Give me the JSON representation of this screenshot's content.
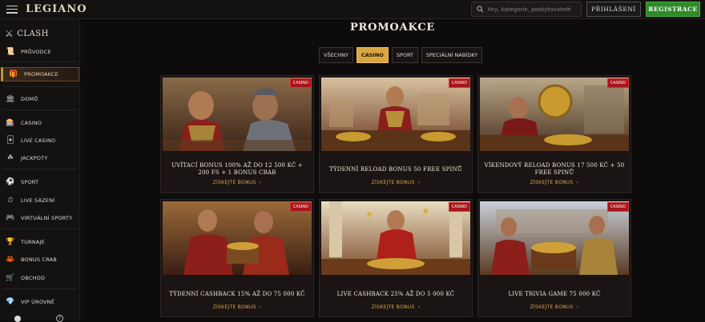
{
  "header": {
    "logo": "LEGIANO",
    "search_placeholder": "Hry, kategorie, poskytovatelé",
    "login_label": "PŘIHLÁŠENÍ",
    "register_label": "REGISTRACE"
  },
  "sidebar": {
    "clash": "CLASH",
    "items": [
      {
        "label": "PRŮVODCE",
        "icon": "scroll-icon"
      },
      {
        "label": "PROMOAKCE",
        "icon": "gift-icon"
      },
      {
        "label": "DOMŮ",
        "icon": "temple-icon"
      },
      {
        "label": "CASINO",
        "icon": "slot-machine-icon"
      },
      {
        "label": "LIVE CASINO",
        "icon": "live-dealer-icon"
      },
      {
        "label": "JACKPOTY",
        "icon": "clover-icon"
      },
      {
        "label": "SPORT",
        "icon": "soccer-ball-icon"
      },
      {
        "label": "LIVE SÁZENÍ",
        "icon": "live-betting-icon"
      },
      {
        "label": "VIRTUÁLNÍ SPORTY",
        "icon": "gamepad-icon"
      },
      {
        "label": "TURNAJE",
        "icon": "trophy-icon"
      },
      {
        "label": "BONUS CRAB",
        "icon": "crab-icon"
      },
      {
        "label": "OBCHOD",
        "icon": "shop-icon"
      },
      {
        "label": "VIP ÚROVNĚ",
        "icon": "diamond-icon"
      }
    ]
  },
  "main": {
    "title": "PROMOAKCE",
    "filters": [
      "VŠECHNY",
      "CASINO",
      "SPORT",
      "SPECIÁLNÍ NABÍDKY"
    ],
    "active_filter": "CASINO",
    "cta": "ZÍSKEJTE BONUS",
    "cards": [
      {
        "badge": "CASINO",
        "title": "UVÍTACÍ BONUS 100% AŽ DO 12 500 KČ + 200 FS + 1 BONUS CRAB"
      },
      {
        "badge": "CASINO",
        "title": "TÝDENNÍ RELOAD BONUS 50 FREE SPINŮ"
      },
      {
        "badge": "CASINO",
        "title": "VÍKENDOVÝ RELOAD BONUS 17 500 KČ + 50 FREE SPINŮ"
      },
      {
        "badge": "CASINO",
        "title": "TÝDENNÍ CASHBACK 15% AŽ DO 75 000 KČ"
      },
      {
        "badge": "CASINO",
        "title": "LIVE CASHBACK 25% AŽ DO 5 000 KČ"
      },
      {
        "badge": "CASINO",
        "title": "LIVE TRIVIA GAME 75 000 KČ"
      }
    ]
  },
  "colors": {
    "accent_gold": "#d9a640",
    "register_green": "#2f8a2a",
    "badge_red": "#a8141a",
    "background": "#0d0b0b"
  }
}
